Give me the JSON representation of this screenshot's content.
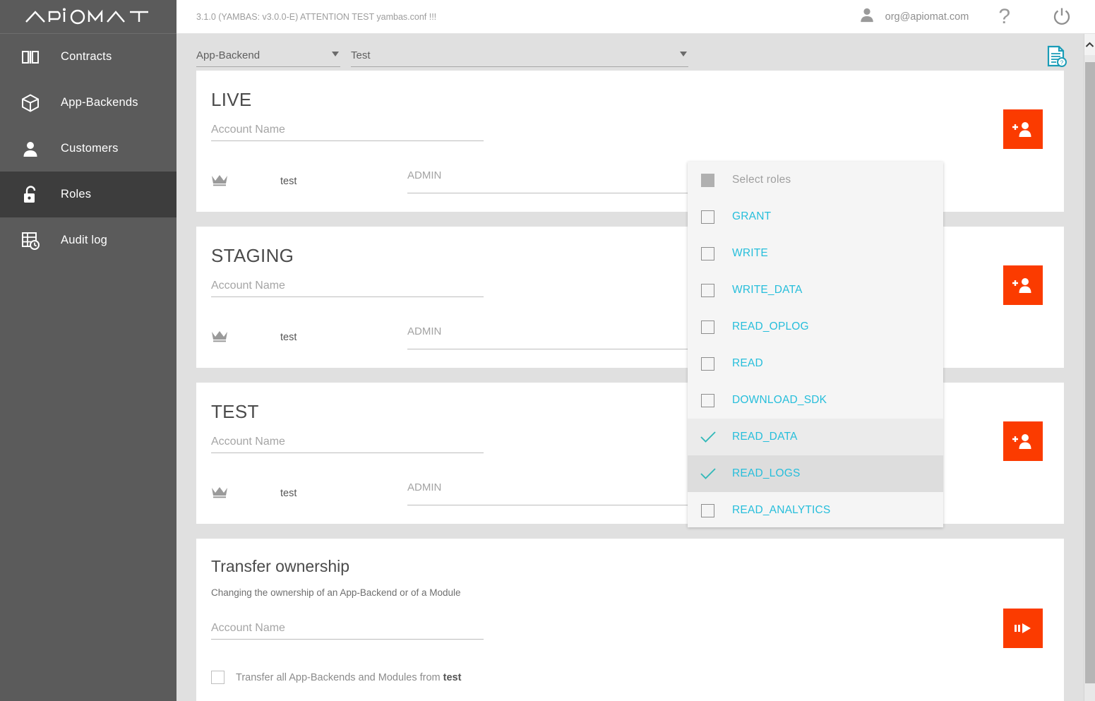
{
  "brand": {
    "logo_text": "APIOMAT",
    "accent_orange": "#fb3b00",
    "accent_teal": "#26bedb",
    "sidebar_bg": "#5b5b5b",
    "sidebar_active_bg": "#3d3d3d"
  },
  "sidebar": {
    "items": [
      {
        "label": "Contracts",
        "icon": "book-icon",
        "active": false
      },
      {
        "label": "App-Backends",
        "icon": "cube-icon",
        "active": false
      },
      {
        "label": "Customers",
        "icon": "person-icon",
        "active": false
      },
      {
        "label": "Roles",
        "icon": "unlocked-padlock-icon",
        "active": true
      },
      {
        "label": "Audit log",
        "icon": "audit-log-icon",
        "active": false
      }
    ]
  },
  "topbar": {
    "version_text": "3.1.0 (YAMBAS: v3.0.0-E) ATTENTION TEST yambas.conf !!!",
    "user_email": "org@apiomat.com",
    "user_icon": "person-icon",
    "help_label": "?",
    "help_icon": "question-mark-icon",
    "power_icon": "power-off-icon"
  },
  "selectors": {
    "backend": {
      "value": "App-Backend",
      "caret_icon": "chevron-down-icon"
    },
    "environment": {
      "value": "Test",
      "caret_icon": "chevron-down-icon"
    },
    "doc_icon": "document-info-icon"
  },
  "cards": [
    {
      "title": "LIVE",
      "account_placeholder": "Account Name",
      "account_value": "",
      "owner_icon": "crown-icon",
      "owner_name": "test",
      "role_value": "ADMIN",
      "role_caret_icon": "chevron-down-icon",
      "add_button_icon": "add-person-icon"
    },
    {
      "title": "STAGING",
      "account_placeholder": "Account Name",
      "account_value": "",
      "owner_icon": "crown-icon",
      "owner_name": "test",
      "role_value": "ADMIN",
      "role_caret_icon": "chevron-down-icon",
      "add_button_icon": "add-person-icon"
    },
    {
      "title": "TEST",
      "account_placeholder": "Account Name",
      "account_value": "",
      "owner_icon": "crown-icon",
      "owner_name": "test",
      "role_value": "ADMIN",
      "role_caret_icon": "chevron-down-icon",
      "add_button_icon": "add-person-icon"
    }
  ],
  "transfer": {
    "title": "Transfer ownership",
    "description": "Changing the ownership of an App-Backend or of a Module",
    "account_placeholder": "Account Name",
    "account_value": "",
    "checkbox_checked": false,
    "checkbox_label_pre": "Transfer all App-Backends and Modules from ",
    "checkbox_label_bold": "test",
    "button_icon": "transfer-forward-icon"
  },
  "roles_dropdown": {
    "header_label": "Select roles",
    "header_state": "indeterminate",
    "items": [
      {
        "label": "GRANT",
        "checked": false,
        "highlight": "none"
      },
      {
        "label": "WRITE",
        "checked": false,
        "highlight": "none"
      },
      {
        "label": "WRITE_DATA",
        "checked": false,
        "highlight": "none"
      },
      {
        "label": "READ_OPLOG",
        "checked": false,
        "highlight": "none"
      },
      {
        "label": "READ",
        "checked": false,
        "highlight": "none"
      },
      {
        "label": "DOWNLOAD_SDK",
        "checked": false,
        "highlight": "none"
      },
      {
        "label": "READ_DATA",
        "checked": true,
        "highlight": "selected"
      },
      {
        "label": "READ_LOGS",
        "checked": true,
        "highlight": "hover"
      },
      {
        "label": "READ_ANALYTICS",
        "checked": false,
        "highlight": "none"
      }
    ]
  },
  "scrollbar": {
    "up_icon": "chevron-up-icon",
    "position": "top"
  }
}
